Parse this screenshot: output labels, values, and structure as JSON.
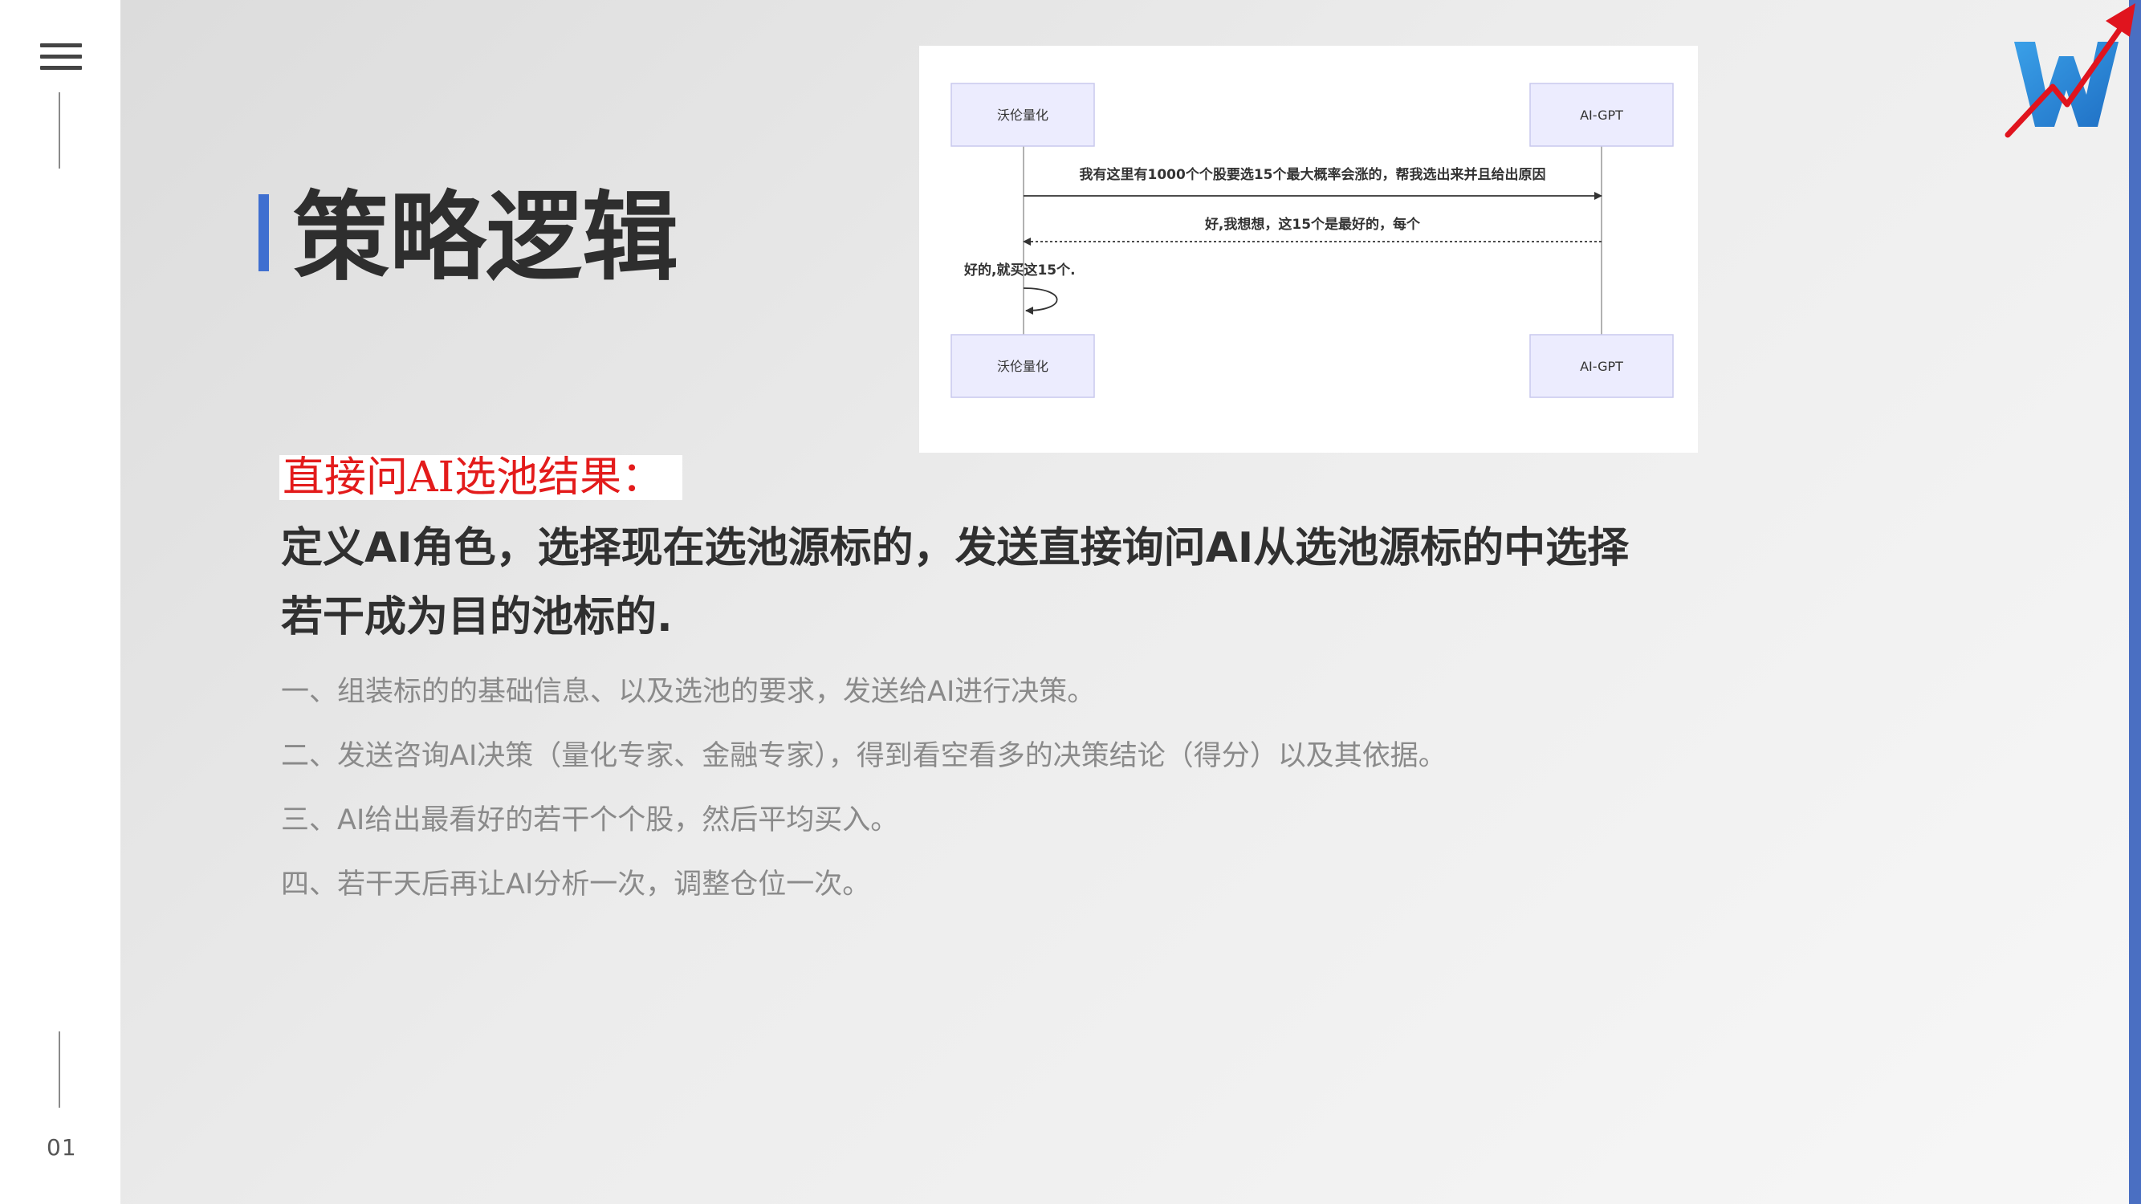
{
  "sidebar": {
    "page_number": "01"
  },
  "title": "策略逻辑",
  "diagram": {
    "participants": {
      "left": "沃伦量化",
      "right": "AI-GPT"
    },
    "messages": {
      "request": "我有这里有1000个个股要选15个最大概率会涨的，帮我选出来并且给出原因",
      "reply": "好,我想想，这15个是最好的，每个",
      "self": "好的,就买这15个."
    }
  },
  "subtitle": "直接问AI选池结果：",
  "headline": "定义AI角色，选择现在选池源标的，发送直接询问AI从选池源标的中选择若干成为目的池标的.",
  "steps": [
    "一、组装标的的基础信息、以及选池的要求，发送给AI进行决策。",
    "二、发送咨询AI决策（量化专家、金融专家），得到看空看多的决策结论（得分）以及其依据。",
    "三、AI给出最看好的若干个个股，然后平均买入。",
    "四、若干天后再让AI分析一次，调整仓位一次。"
  ],
  "colors": {
    "accent_blue": "#3f6fd0",
    "subtitle_red": "#e31b1b",
    "logo_red": "#e0141e",
    "logo_blue": "#2b8fd8"
  }
}
